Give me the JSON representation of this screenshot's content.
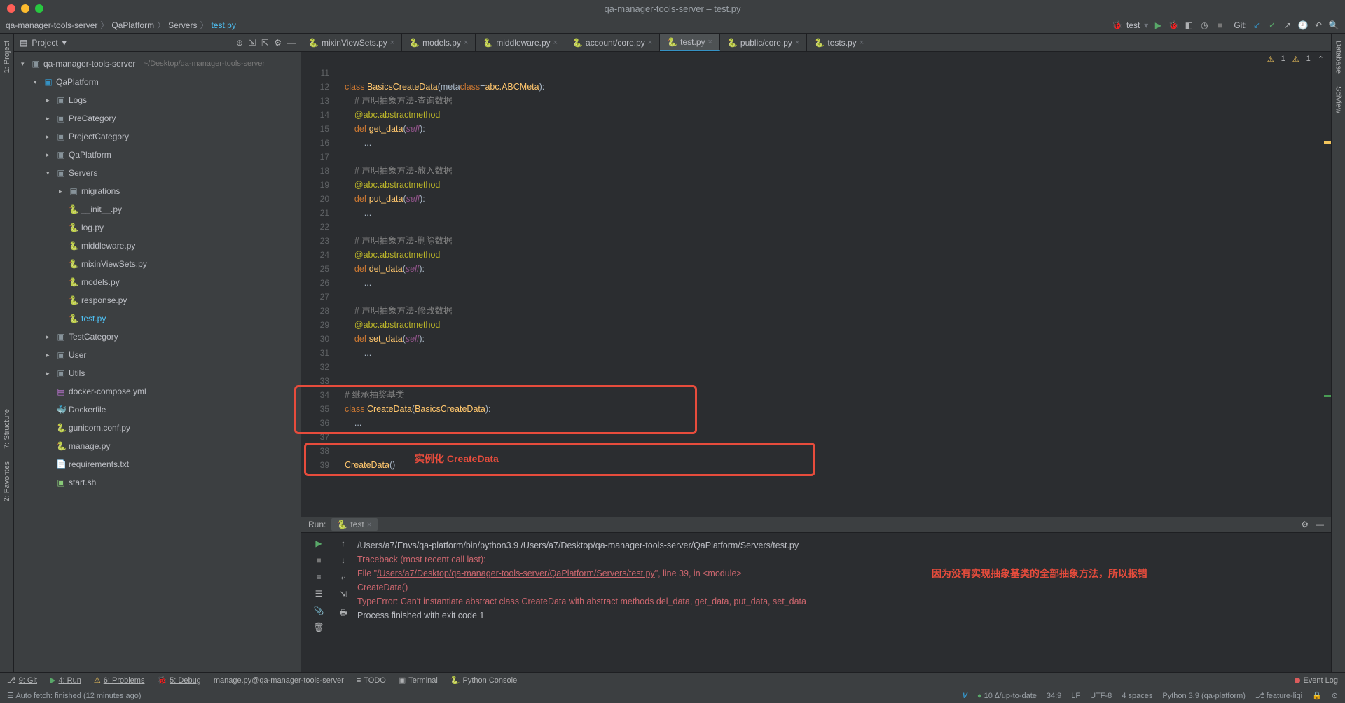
{
  "titlebar": {
    "title": "qa-manager-tools-server – test.py"
  },
  "breadcrumb": {
    "parts": [
      "qa-manager-tools-server",
      "QaPlatform",
      "Servers",
      "test.py"
    ]
  },
  "nav_right": {
    "run_config": "test",
    "git_label": "Git:"
  },
  "sidebar": {
    "header": "Project",
    "root": {
      "name": "qa-manager-tools-server",
      "hint": "~/Desktop/qa-manager-tools-server"
    },
    "qa": "QaPlatform",
    "nodes": {
      "logs": "Logs",
      "precategory": "PreCategory",
      "projectcategory": "ProjectCategory",
      "qaplatform": "QaPlatform",
      "servers": "Servers",
      "migrations": "migrations",
      "init": "__init__.py",
      "log": "log.py",
      "middleware": "middleware.py",
      "mixin": "mixinViewSets.py",
      "models": "models.py",
      "response": "response.py",
      "test": "test.py",
      "testcategory": "TestCategory",
      "user": "User",
      "utils": "Utils",
      "docker_compose": "docker-compose.yml",
      "dockerfile": "Dockerfile",
      "gunicorn": "gunicorn.conf.py",
      "manage": "manage.py",
      "requirements": "requirements.txt",
      "start": "start.sh"
    }
  },
  "tabs": [
    {
      "label": "mixinViewSets.py"
    },
    {
      "label": "models.py"
    },
    {
      "label": "middleware.py"
    },
    {
      "label": "account/core.py"
    },
    {
      "label": "test.py",
      "active": true
    },
    {
      "label": "public/core.py"
    },
    {
      "label": "tests.py"
    }
  ],
  "editor_info": {
    "warn1": "1",
    "warn2": "1"
  },
  "code": {
    "lines": [
      {
        "n": 11,
        "t": ""
      },
      {
        "n": 12,
        "t": "class BasicsCreateData(metaclass=abc.ABCMeta):"
      },
      {
        "n": 13,
        "t": "    # 声明抽象方法-查询数据"
      },
      {
        "n": 14,
        "t": "    @abc.abstractmethod"
      },
      {
        "n": 15,
        "t": "    def get_data(self):"
      },
      {
        "n": 16,
        "t": "        ..."
      },
      {
        "n": 17,
        "t": ""
      },
      {
        "n": 18,
        "t": "    # 声明抽象方法-放入数据"
      },
      {
        "n": 19,
        "t": "    @abc.abstractmethod"
      },
      {
        "n": 20,
        "t": "    def put_data(self):"
      },
      {
        "n": 21,
        "t": "        ..."
      },
      {
        "n": 22,
        "t": ""
      },
      {
        "n": 23,
        "t": "    # 声明抽象方法-删除数据"
      },
      {
        "n": 24,
        "t": "    @abc.abstractmethod"
      },
      {
        "n": 25,
        "t": "    def del_data(self):"
      },
      {
        "n": 26,
        "t": "        ..."
      },
      {
        "n": 27,
        "t": ""
      },
      {
        "n": 28,
        "t": "    # 声明抽象方法-修改数据"
      },
      {
        "n": 29,
        "t": "    @abc.abstractmethod"
      },
      {
        "n": 30,
        "t": "    def set_data(self):"
      },
      {
        "n": 31,
        "t": "        ..."
      },
      {
        "n": 32,
        "t": ""
      },
      {
        "n": 33,
        "t": ""
      },
      {
        "n": 34,
        "t": "# 继承抽奖基类"
      },
      {
        "n": 35,
        "t": "class CreateData(BasicsCreateData):"
      },
      {
        "n": 36,
        "t": "    ..."
      },
      {
        "n": 37,
        "t": ""
      },
      {
        "n": 38,
        "t": ""
      },
      {
        "n": 39,
        "t": "CreateData()"
      }
    ]
  },
  "overlays": {
    "o1": "实例化 CreateData",
    "o2": "因为没有实现抽象基类的全部抽象方法，所以报错"
  },
  "run": {
    "label": "Run:",
    "tab": "test",
    "output": {
      "l1": "/Users/a7/Envs/qa-platform/bin/python3.9 /Users/a7/Desktop/qa-manager-tools-server/QaPlatform/Servers/test.py",
      "l2": "Traceback (most recent call last):",
      "l3a": "  File \"",
      "l3b": "/Users/a7/Desktop/qa-manager-tools-server/QaPlatform/Servers/test.py",
      "l3c": "\", line 39, in <module>",
      "l4": "    CreateData()",
      "l5": "TypeError: Can't instantiate abstract class CreateData with abstract methods del_data, get_data, put_data, set_data",
      "l6": "",
      "l7": "Process finished with exit code 1"
    }
  },
  "left_gutter": {
    "project": "1: Project",
    "structure": "7: Structure",
    "favorites": "2: Favorites"
  },
  "right_gutter": {
    "database": "Database",
    "sciview": "SciView"
  },
  "bottombar": {
    "git": "9: Git",
    "run": "4: Run",
    "problems": "6: Problems",
    "debug": "5: Debug",
    "manage": "manage.py@qa-manager-tools-server",
    "todo": "TODO",
    "terminal": "Terminal",
    "console": "Python Console",
    "event_log": "Event Log"
  },
  "statusbar": {
    "left": "Auto fetch: finished (12 minutes ago)",
    "up": "10 ∆/up-to-date",
    "pos": "34:9",
    "sep": "LF",
    "enc": "UTF-8",
    "indent": "4 spaces",
    "python": "Python 3.9 (qa-platform)",
    "branch": "feature-liqi"
  }
}
